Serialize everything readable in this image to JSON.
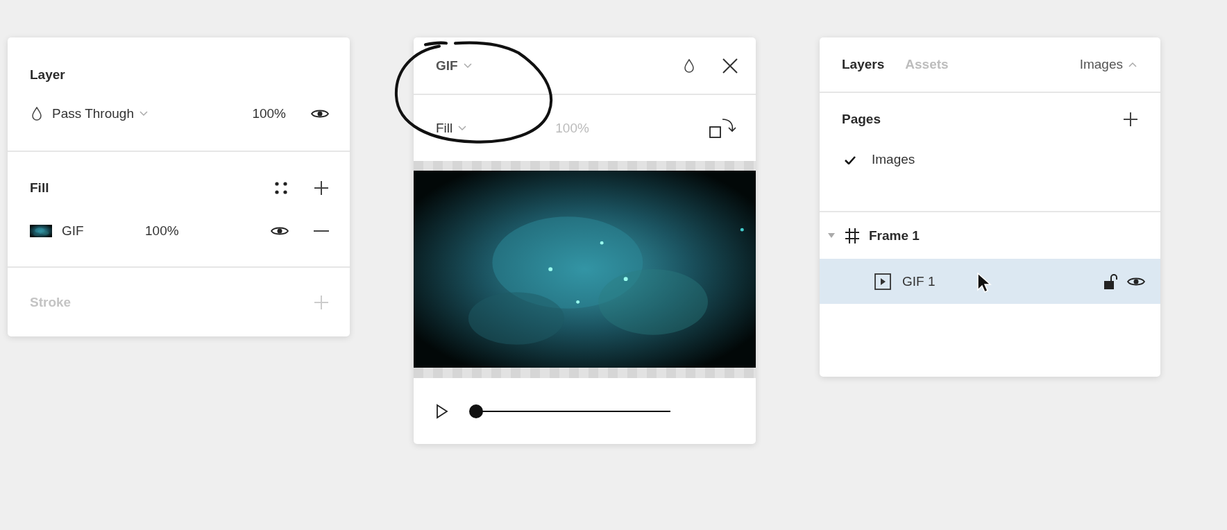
{
  "layer_panel": {
    "title": "Layer",
    "blend": {
      "mode": "Pass Through",
      "opacity": "100%",
      "visible": true
    },
    "fill": {
      "title": "Fill",
      "items": [
        {
          "label": "GIF",
          "opacity": "100%",
          "visible": true
        }
      ]
    },
    "stroke": {
      "title": "Stroke",
      "disabled": true
    }
  },
  "gif_panel": {
    "type_label": "GIF",
    "fit": "Fill",
    "opacity": "100%",
    "playing": false,
    "playback": {
      "level": 0
    }
  },
  "layers_panel": {
    "tabs": [
      {
        "label": "Layers",
        "selected": true
      },
      {
        "label": "Assets",
        "selected": false
      }
    ],
    "page_menu": "Images",
    "pages": {
      "title": "Pages",
      "items": [
        {
          "label": "Images",
          "selected": true
        }
      ]
    },
    "tree": [
      {
        "label": "Frame 1",
        "kind": "frame",
        "expanded": true,
        "selected": false,
        "children": [
          {
            "label": "GIF 1",
            "kind": "gif",
            "selected": true,
            "locked": false,
            "visible": true
          }
        ]
      }
    ]
  }
}
